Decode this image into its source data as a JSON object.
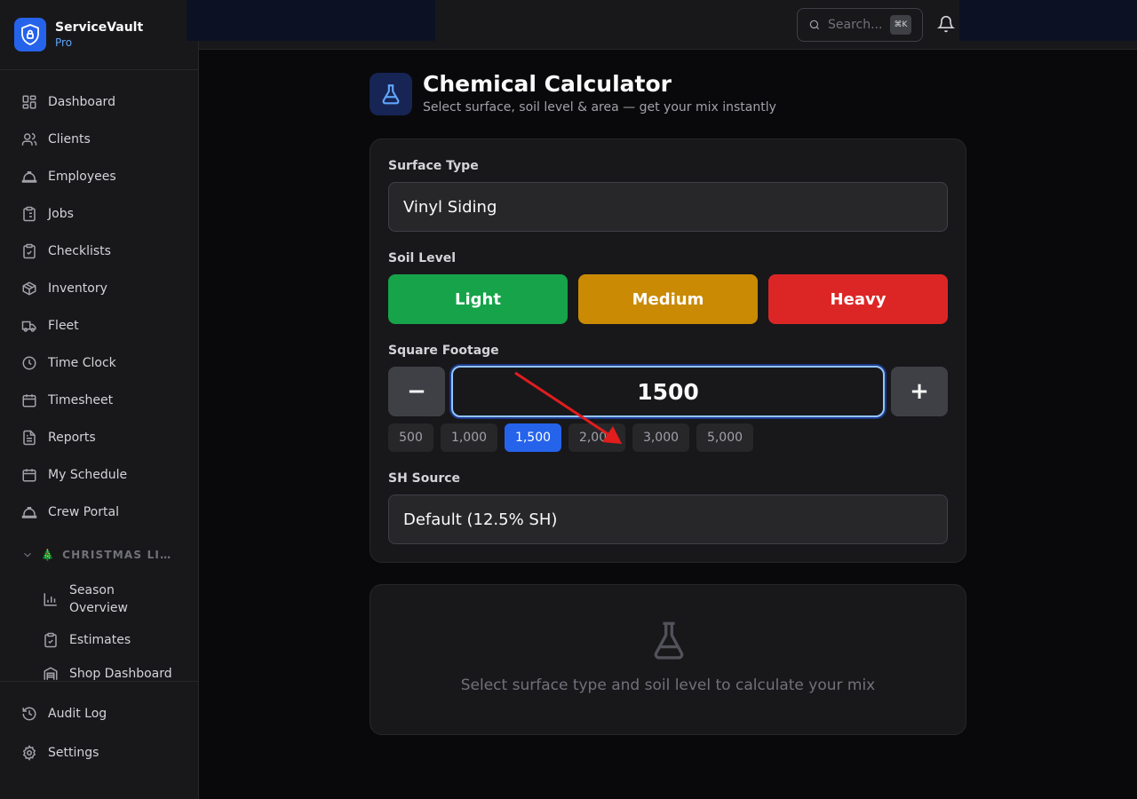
{
  "brand": {
    "name": "ServiceVault",
    "tier": "Pro"
  },
  "sidebar": {
    "items": [
      {
        "label": "Dashboard",
        "icon": "dashboard-icon"
      },
      {
        "label": "Clients",
        "icon": "users-icon"
      },
      {
        "label": "Employees",
        "icon": "hardhat-icon"
      },
      {
        "label": "Jobs",
        "icon": "clipboard-list-icon"
      },
      {
        "label": "Checklists",
        "icon": "clipboard-check-icon"
      },
      {
        "label": "Inventory",
        "icon": "package-icon"
      },
      {
        "label": "Fleet",
        "icon": "truck-icon"
      },
      {
        "label": "Time Clock",
        "icon": "clock-icon"
      },
      {
        "label": "Timesheet",
        "icon": "calendar-icon"
      },
      {
        "label": "Reports",
        "icon": "file-text-icon"
      },
      {
        "label": "My Schedule",
        "icon": "calendar-icon"
      },
      {
        "label": "Crew Portal",
        "icon": "hardhat-icon"
      }
    ],
    "section": {
      "emoji": "🎄",
      "title": "CHRISTMAS LIG…",
      "items": [
        {
          "label": "Season Overview",
          "icon": "bar-chart-icon"
        },
        {
          "label": "Estimates",
          "icon": "clipboard-check-icon"
        },
        {
          "label": "Shop Dashboard",
          "icon": "warehouse-icon"
        }
      ]
    },
    "bottom": [
      {
        "label": "Audit Log",
        "icon": "history-icon"
      },
      {
        "label": "Settings",
        "icon": "gear-icon"
      }
    ]
  },
  "topbar": {
    "search_placeholder": "Search...",
    "shortcut": "⌘K"
  },
  "page": {
    "title": "Chemical Calculator",
    "subtitle": "Select surface, soil level & area — get your mix instantly"
  },
  "form": {
    "surface_label": "Surface Type",
    "surface_value": "Vinyl Siding",
    "soil_label": "Soil Level",
    "soil_options": [
      "Light",
      "Medium",
      "Heavy"
    ],
    "soil_colors": [
      "#16a34a",
      "#ca8a04",
      "#dc2626"
    ],
    "sqft_label": "Square Footage",
    "sqft_value": "1500",
    "decrement_label": "−",
    "increment_label": "+",
    "presets": [
      "500",
      "1,000",
      "1,500",
      "2,000",
      "3,000",
      "5,000"
    ],
    "active_preset": "1,500",
    "sh_label": "SH Source",
    "sh_value": "Default (12.5% SH)"
  },
  "result": {
    "empty_message": "Select surface type and soil level to calculate your mix"
  },
  "colors": {
    "accent": "#2563eb",
    "annotation_arrow": "#e11d1d"
  }
}
